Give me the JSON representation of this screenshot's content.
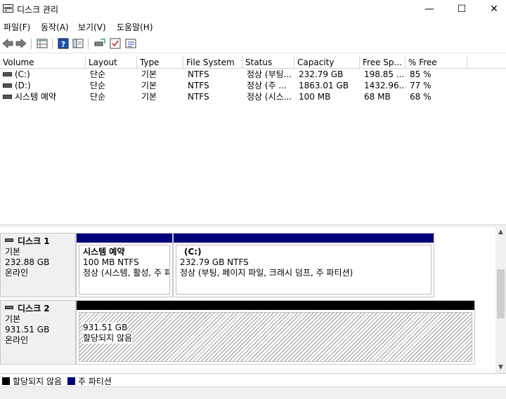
{
  "window": {
    "title": "디스크 관리",
    "minimize": "—",
    "maximize": "☐",
    "close": "✕"
  },
  "menu": [
    {
      "label": "파일(F)"
    },
    {
      "label": "동작(A)"
    },
    {
      "label": "보기(V)"
    },
    {
      "label": "도움말(H)"
    }
  ],
  "toolbar": {
    "buttons": [
      "back-arrow-icon",
      "forward-arrow-icon",
      "properties-grid-icon",
      "help-icon",
      "console-tree-icon",
      "rescan-icon",
      "check-icon",
      "list-view-icon"
    ]
  },
  "volume_list": {
    "columns": [
      "Volume",
      "Layout",
      "Type",
      "File System",
      "Status",
      "Capacity",
      "Free Sp...",
      "% Free"
    ],
    "rows": [
      [
        "(C:)",
        "단순",
        "기본",
        "NTFS",
        "정상 (부팅...",
        "232.79 GB",
        "198.85 ...",
        "85 %"
      ],
      [
        "(D:)",
        "단순",
        "기본",
        "NTFS",
        "정상 (주 ...",
        "1863.01 GB",
        "1432.96...",
        "77 %"
      ],
      [
        "시스템 예약",
        "단순",
        "기본",
        "NTFS",
        "정상 (시스...",
        "100 MB",
        "68 MB",
        "68 %"
      ]
    ]
  },
  "disks": [
    {
      "title": "디스크 1",
      "type": "기본",
      "size": "232.88 GB",
      "state": "온라인",
      "partitions": [
        {
          "name": "시스템 예약",
          "size": "100 MB NTFS",
          "status": "정상 (시스템, 활성, 주 파티션)"
        },
        {
          "name": "(C:)",
          "size": "232.79 GB NTFS",
          "status": "정상 (부팅, 페이지 파일, 크래시 덤프, 주 파티션)"
        }
      ]
    },
    {
      "title": "디스크 2",
      "type": "기본",
      "size": "931.51 GB",
      "state": "온라인",
      "partitions": [
        {
          "size": "931.51 GB",
          "status": "할당되지 않음"
        }
      ]
    }
  ],
  "legend": [
    {
      "label": "할당되지 않음",
      "color": "#000000"
    },
    {
      "label": "주 파티션",
      "color": "#00007b"
    }
  ],
  "colors": {
    "primary_partition": "#00007b",
    "unallocated": "#000000"
  }
}
